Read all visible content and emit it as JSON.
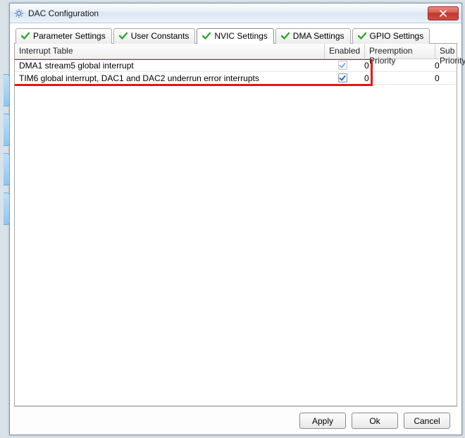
{
  "window": {
    "title": "DAC Configuration"
  },
  "tabs": [
    {
      "label": "Parameter Settings"
    },
    {
      "label": "User Constants"
    },
    {
      "label": "NVIC Settings"
    },
    {
      "label": "DMA Settings"
    },
    {
      "label": "GPIO Settings"
    }
  ],
  "active_tab_index": 2,
  "table": {
    "headers": {
      "interrupt": "Interrupt Table",
      "enabled": "Enabled",
      "preemption": "Preemption Priority",
      "sub": "Sub Priority"
    },
    "rows": [
      {
        "interrupt": "DMA1 stream5 global interrupt",
        "enabled": true,
        "enabled_locked": true,
        "preemption": "0",
        "sub": "0"
      },
      {
        "interrupt": "TIM6 global interrupt, DAC1 and DAC2 underrun error interrupts",
        "enabled": true,
        "enabled_locked": false,
        "preemption": "0",
        "sub": "0"
      }
    ]
  },
  "buttons": {
    "apply": "Apply",
    "ok": "Ok",
    "cancel": "Cancel"
  }
}
